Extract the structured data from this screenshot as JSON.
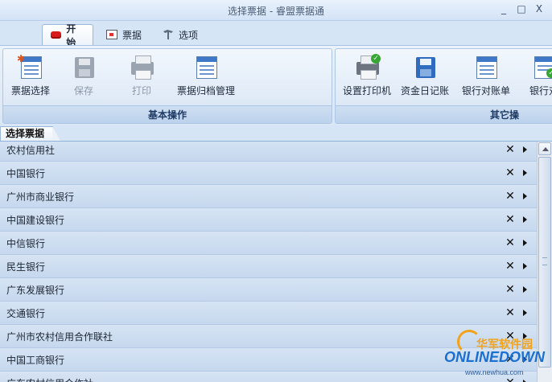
{
  "window": {
    "title": "选择票据 - 睿盟票据通",
    "minimize": "_",
    "maximize": "□",
    "close": "X"
  },
  "tabs": [
    {
      "label": "开始",
      "icon": "start-icon",
      "active": true
    },
    {
      "label": "票据",
      "icon": "ticket-icon",
      "active": false
    },
    {
      "label": "选项",
      "icon": "options-icon",
      "active": false
    }
  ],
  "ribbon": {
    "group_basic": {
      "label": "基本操作",
      "buttons": [
        {
          "label": "票据选择",
          "icon": "ticket-select-icon",
          "enabled": true
        },
        {
          "label": "保存",
          "icon": "save-icon",
          "enabled": false
        },
        {
          "label": "打印",
          "icon": "print-icon",
          "enabled": false
        },
        {
          "label": "票据归档管理",
          "icon": "archive-icon",
          "enabled": true
        }
      ]
    },
    "group_other": {
      "label": "其它操",
      "buttons": [
        {
          "label": "设置打印机",
          "icon": "printer-setup-icon",
          "enabled": true
        },
        {
          "label": "资金日记账",
          "icon": "cash-journal-icon",
          "enabled": true
        },
        {
          "label": "银行对账单",
          "icon": "bank-statement-icon",
          "enabled": true
        },
        {
          "label": "银行对",
          "icon": "bank-reconcile-icon",
          "enabled": true
        }
      ]
    }
  },
  "panel": {
    "tab_label": "选择票据",
    "rows": [
      {
        "label": "农村信用社"
      },
      {
        "label": "中国银行"
      },
      {
        "label": "广州市商业银行"
      },
      {
        "label": "中国建设银行"
      },
      {
        "label": "中信银行"
      },
      {
        "label": "民生银行"
      },
      {
        "label": "广东发展银行"
      },
      {
        "label": "交通银行"
      },
      {
        "label": "广州市农村信用合作联社"
      },
      {
        "label": "中国工商银行"
      },
      {
        "label": "广东农村信用合作社"
      }
    ],
    "close_glyph": "✕"
  },
  "watermark": {
    "cn": "华军软件园",
    "logo": "ONLINEDOWN",
    "url": "www.newhua.com"
  }
}
